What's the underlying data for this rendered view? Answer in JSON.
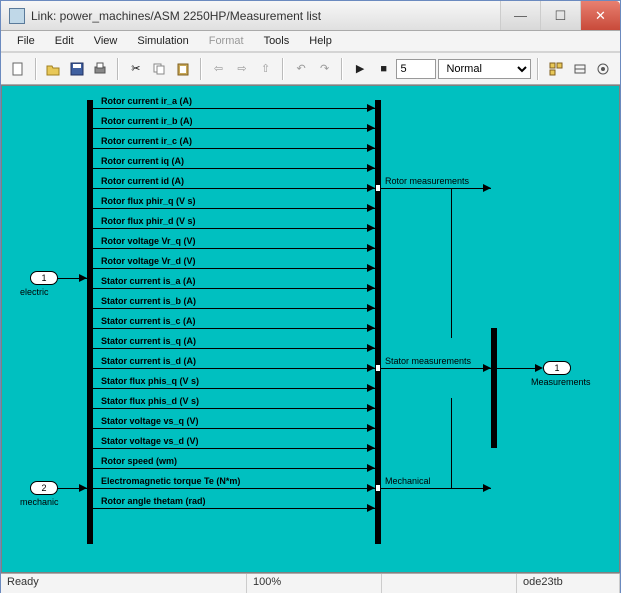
{
  "window": {
    "title": "Link: power_machines/ASM 2250HP/Measurement list"
  },
  "menu": {
    "file": "File",
    "edit": "Edit",
    "view": "View",
    "simulation": "Simulation",
    "format": "Format",
    "tools": "Tools",
    "help": "Help"
  },
  "toolbar": {
    "steps": "5",
    "mode": "Normal"
  },
  "statusbar": {
    "ready": "Ready",
    "zoom": "100%",
    "blank": "",
    "solver": "ode23tb"
  },
  "ports": {
    "electric": {
      "num": "1",
      "label": "electric"
    },
    "mechanic": {
      "num": "2",
      "label": "mechanic"
    },
    "measurements": {
      "num": "1",
      "label": "Measurements"
    }
  },
  "bus_labels": {
    "rotor": "Rotor measurements",
    "stator": "Stator measurements",
    "mech": "Mechanical"
  },
  "signals": [
    "Rotor current ir_a (A)",
    "Rotor current ir_b (A)",
    "Rotor current ir_c (A)",
    "Rotor current  iq (A)",
    "Rotor current  id (A)",
    "Rotor flux phir_q (V s)",
    "Rotor flux phir_d (V s)",
    "Rotor voltage Vr_q (V)",
    "Rotor voltage Vr_d (V)",
    "Stator current is_a (A)",
    "Stator current is_b (A)",
    "Stator current is_c (A)",
    "Stator current is_q (A)",
    "Stator current is_d (A)",
    "Stator flux phis_q (V s)",
    "Stator flux phis_d (V s)",
    "Stator voltage vs_q (V)",
    "Stator voltage vs_d (V)",
    "Rotor speed (wm)",
    "Electromagnetic torque Te (N*m)",
    "Rotor angle thetam (rad)"
  ],
  "chart_data": {
    "type": "diagram",
    "title": "Measurement list",
    "inputs": [
      {
        "port": 1,
        "name": "electric"
      },
      {
        "port": 2,
        "name": "mechanic"
      }
    ],
    "outputs": [
      {
        "port": 1,
        "name": "Measurements"
      }
    ],
    "bus_groups": [
      {
        "name": "Rotor measurements",
        "signals": [
          "Rotor current ir_a (A)",
          "Rotor current ir_b (A)",
          "Rotor current ir_c (A)",
          "Rotor current  iq (A)",
          "Rotor current  id (A)",
          "Rotor flux phir_q (V s)",
          "Rotor flux phir_d (V s)",
          "Rotor voltage Vr_q (V)",
          "Rotor voltage Vr_d (V)"
        ]
      },
      {
        "name": "Stator measurements",
        "signals": [
          "Stator current is_a (A)",
          "Stator current is_b (A)",
          "Stator current is_c (A)",
          "Stator current is_q (A)",
          "Stator current is_d (A)",
          "Stator flux phis_q (V s)",
          "Stator flux phis_d (V s)",
          "Stator voltage vs_q (V)",
          "Stator voltage vs_d (V)"
        ]
      },
      {
        "name": "Mechanical",
        "signals": [
          "Rotor speed (wm)",
          "Electromagnetic torque Te (N*m)",
          "Rotor angle thetam (rad)"
        ]
      }
    ]
  }
}
